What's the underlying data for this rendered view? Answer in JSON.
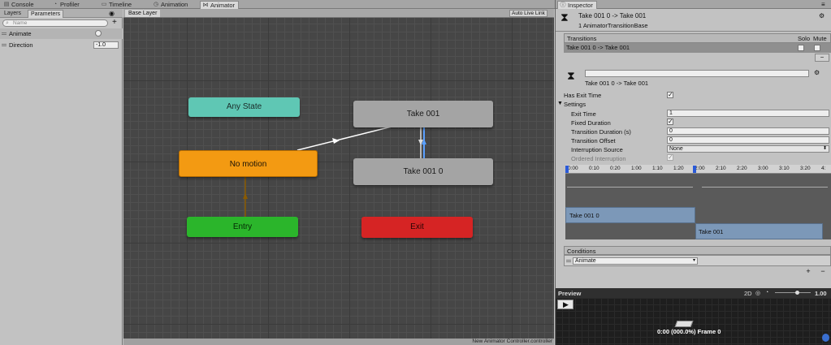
{
  "top_tabs": [
    {
      "label": "Console",
      "icon": "console-icon"
    },
    {
      "label": "Profiler",
      "icon": "profiler-icon"
    },
    {
      "label": "Timeline",
      "icon": "timeline-icon"
    },
    {
      "label": "Animation",
      "icon": "animation-icon"
    },
    {
      "label": "Animator",
      "icon": "animator-icon",
      "active": true
    }
  ],
  "left_panel": {
    "tabs": [
      "Layers",
      "Parameters"
    ],
    "search_placeholder": "Name",
    "add_symbol": "+",
    "parameters": [
      {
        "name": "Animate",
        "type": "bool",
        "value": false
      },
      {
        "name": "Direction",
        "type": "float",
        "value": "-1.0"
      }
    ]
  },
  "graph": {
    "breadcrumb": "Base Layer",
    "auto_live_link": "Auto Live Link",
    "status": "New Animator Controller.controller",
    "states": [
      {
        "name": "Any State",
        "color": "#5fc7b4"
      },
      {
        "name": "No motion",
        "color": "#f39a12"
      },
      {
        "name": "Entry",
        "color": "#2bb52b"
      },
      {
        "name": "Take 001",
        "color": "#a4a4a4"
      },
      {
        "name": "Take 001 0",
        "color": "#a4a4a4"
      },
      {
        "name": "Exit",
        "color": "#d62424"
      }
    ]
  },
  "inspector": {
    "tab": "Inspector",
    "header_title": "Take 001 0 -> Take 001",
    "header_subtitle": "1 AnimatorTransitionBase",
    "transitions_label": "Transitions",
    "solo_label": "Solo",
    "mute_label": "Mute",
    "transition_row": "Take 001 0 -> Take 001",
    "minus": "−",
    "transition_name_field": "",
    "transition_subtitle": "Take 001 0 -> Take 001",
    "has_exit_time_label": "Has Exit Time",
    "has_exit_time": true,
    "settings_label": "Settings",
    "settings": [
      {
        "label": "Exit Time",
        "value": "1"
      },
      {
        "label": "Fixed Duration",
        "checkbox": true
      },
      {
        "label": "Transition Duration (s)",
        "value": "0"
      },
      {
        "label": "Transition Offset",
        "value": "0"
      },
      {
        "label": "Interruption Source",
        "value": "None"
      },
      {
        "label": "Ordered Interruption",
        "checkbox": true
      }
    ],
    "timeline_ticks": [
      "0:00",
      "0:10",
      "0:20",
      "1:00",
      "1:10",
      "1:20",
      "2:00",
      "2:10",
      "2:20",
      "3:00",
      "3:10",
      "3:20",
      "4:"
    ],
    "clip_a": "Take 001 0",
    "clip_b": "Take 001",
    "conditions_label": "Conditions",
    "condition_param": "Animate",
    "plus": "+",
    "preview_label": "Preview",
    "preview_mode": "2D",
    "preview_speed": "1.00",
    "preview_frame": "0:00 (000.0%) Frame 0"
  }
}
